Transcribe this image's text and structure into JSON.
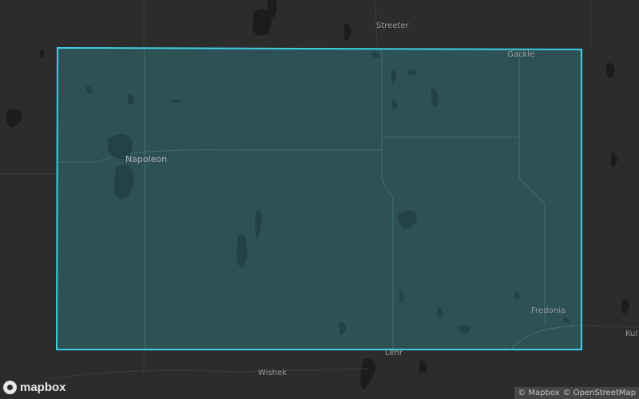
{
  "map": {
    "places": {
      "streeter": "Streeter",
      "gackle": "Gackle",
      "napoleon": "Napoleon",
      "fredonia": "Fredonia",
      "lehr": "Lehr",
      "wishek": "Wishek",
      "kulm": "Kul"
    },
    "highlight": {
      "fill": "#2f5d63",
      "stroke": "#3ccfe6"
    }
  },
  "footer": {
    "logo_text": "mapbox",
    "attribution": {
      "mapbox": "© Mapbox",
      "osm": "© OpenStreetMap"
    }
  }
}
